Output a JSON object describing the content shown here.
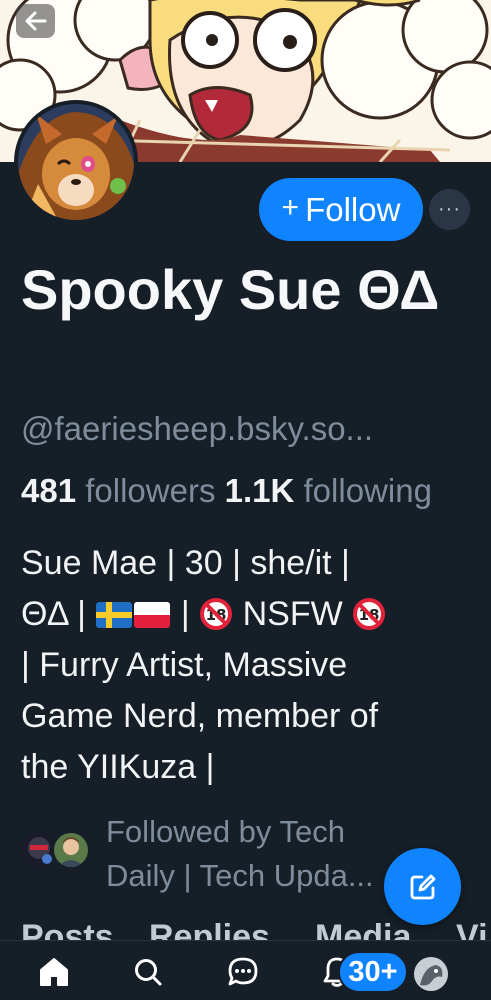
{
  "profile": {
    "display_name": "Spooky Sue ΘΔ",
    "handle": "@faeriesheep.bsky.so...",
    "followers_count": "481",
    "followers_label": "followers",
    "following_count": "1.1K",
    "following_label": "following",
    "bio": {
      "line1": "Sue Mae | 30 | she/it |",
      "line2_start": "ΘΔ |",
      "line2_sep": "|",
      "line2_nsfw": "NSFW",
      "line3": "| Furry Artist, Massive",
      "line4": "Game Nerd, member of",
      "line5": "the YIIKuza |"
    },
    "followed_by": {
      "line1": "Followed by Tech",
      "line2": "Daily | Tech Upda..."
    }
  },
  "actions": {
    "follow_label": "Follow",
    "follow_icon": "plus-icon",
    "more_label": "···"
  },
  "tabs": [
    "Posts",
    "Replies",
    "Media",
    "Vi"
  ],
  "nav": {
    "items": [
      "home-icon",
      "search-icon",
      "chat-icon",
      "bell-icon",
      "profile-avatar"
    ],
    "notification_badge": "30+"
  },
  "colors": {
    "background": "#161e27",
    "accent": "#1083fe",
    "muted_text": "#7e8c9b"
  }
}
